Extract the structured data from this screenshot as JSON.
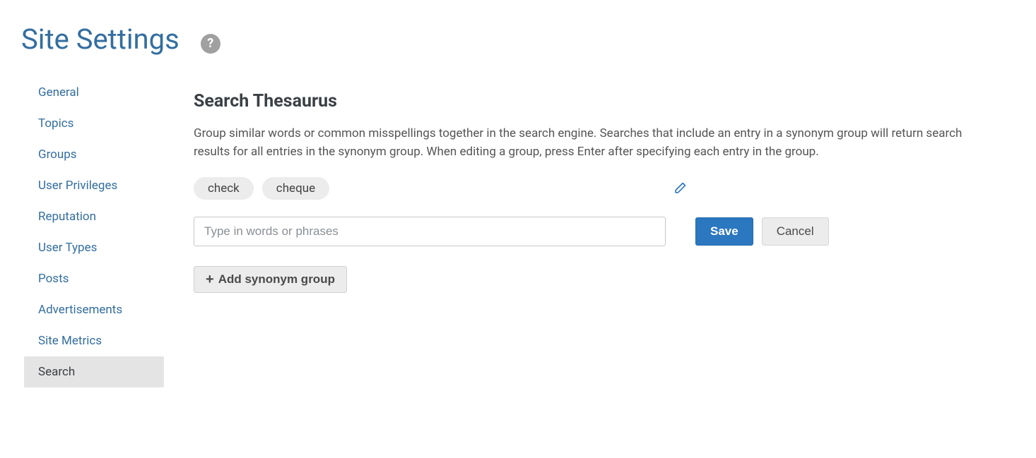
{
  "header": {
    "title": "Site Settings"
  },
  "sidebar": {
    "items": [
      {
        "label": "General",
        "active": false
      },
      {
        "label": "Topics",
        "active": false
      },
      {
        "label": "Groups",
        "active": false
      },
      {
        "label": "User Privileges",
        "active": false
      },
      {
        "label": "Reputation",
        "active": false
      },
      {
        "label": "User Types",
        "active": false
      },
      {
        "label": "Posts",
        "active": false
      },
      {
        "label": "Advertisements",
        "active": false
      },
      {
        "label": "Site Metrics",
        "active": false
      },
      {
        "label": "Search",
        "active": true
      }
    ]
  },
  "main": {
    "section_title": "Search Thesaurus",
    "section_desc": "Group similar words or common misspellings together in the search engine. Searches that include an entry in a synonym group will return search results for all entries in the synonym group. When editing a group, press Enter after specifying each entry in the group.",
    "group": {
      "chips": [
        "check",
        "cheque"
      ]
    },
    "input_placeholder": "Type in words or phrases",
    "save_label": "Save",
    "cancel_label": "Cancel",
    "add_group_label": "Add synonym group"
  }
}
